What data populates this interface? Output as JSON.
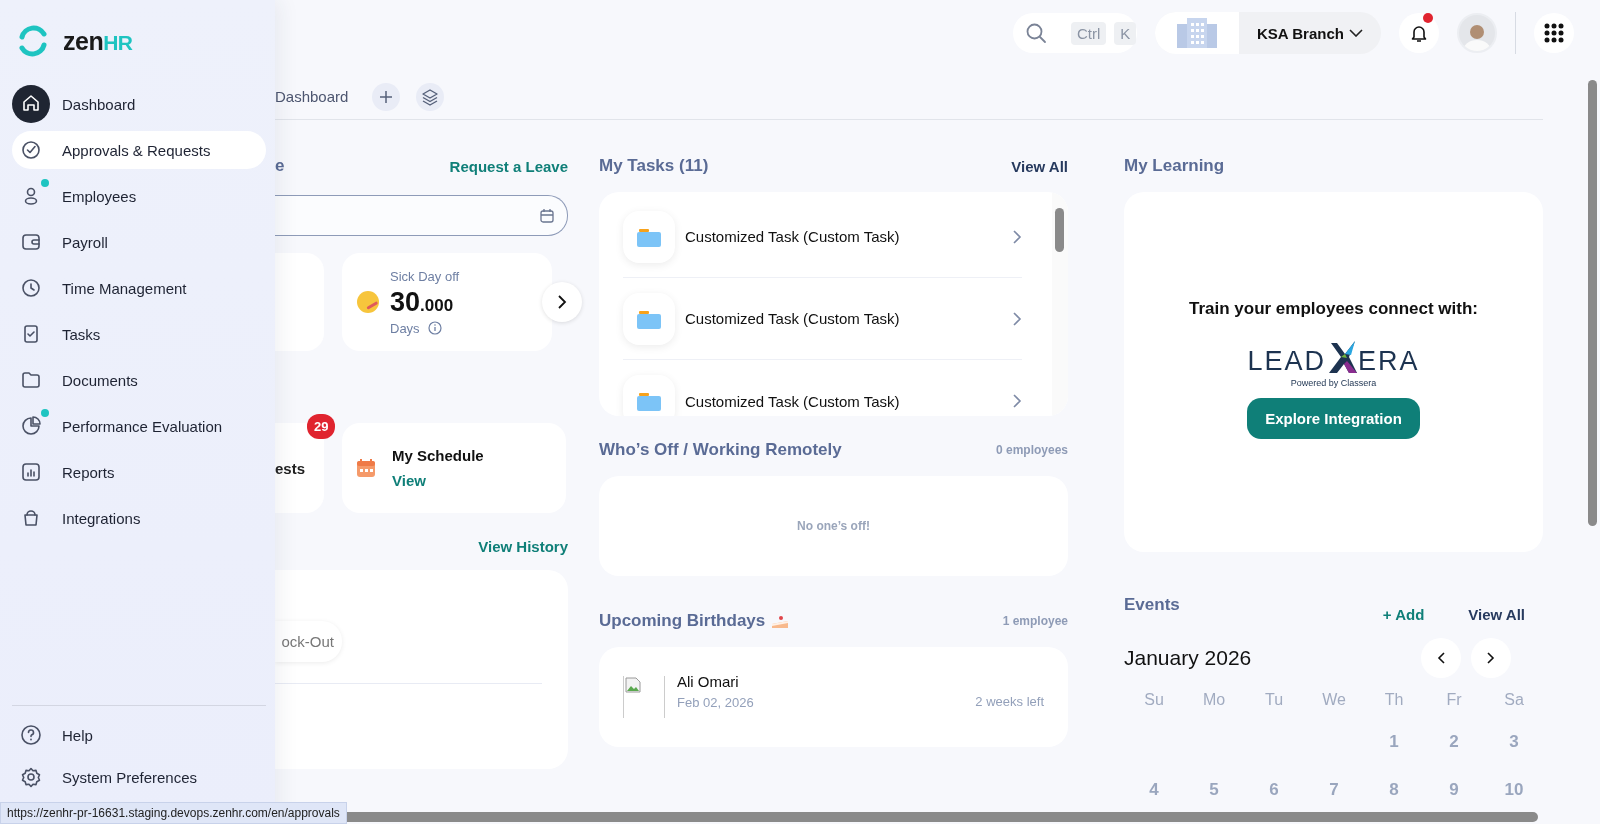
{
  "sidebar": {
    "logo": {
      "word": "zen",
      "accent": "HR"
    },
    "items": [
      {
        "label": "Dashboard",
        "selected": true,
        "highlighted": false,
        "dot": false
      },
      {
        "label": "Approvals & Requests",
        "selected": false,
        "highlighted": true,
        "dot": false
      },
      {
        "label": "Employees",
        "selected": false,
        "highlighted": false,
        "dot": true
      },
      {
        "label": "Payroll",
        "selected": false,
        "highlighted": false,
        "dot": false
      },
      {
        "label": "Time Management",
        "selected": false,
        "highlighted": false,
        "dot": false
      },
      {
        "label": "Tasks",
        "selected": false,
        "highlighted": false,
        "dot": false
      },
      {
        "label": "Documents",
        "selected": false,
        "highlighted": false,
        "dot": false
      },
      {
        "label": "Performance Evaluation",
        "selected": false,
        "highlighted": false,
        "dot": true
      },
      {
        "label": "Reports",
        "selected": false,
        "highlighted": false,
        "dot": false
      },
      {
        "label": "Integrations",
        "selected": false,
        "highlighted": false,
        "dot": false
      }
    ],
    "footer_items": [
      {
        "label": "Help"
      },
      {
        "label": "System Preferences"
      }
    ]
  },
  "header": {
    "search": {
      "keys": [
        "Ctrl",
        "K"
      ]
    },
    "branch": "KSA Branch",
    "unread_notifications": true
  },
  "page_tab": {
    "label": "Dashboard"
  },
  "leave": {
    "title": "e",
    "link": "Request a Leave",
    "balance_cards": [
      {
        "label": "Sick Day off",
        "value": "30",
        "decimals": ".000",
        "unit": "Days"
      }
    ]
  },
  "quick_links": [
    {
      "kind": "cut",
      "label": "ests",
      "badge": "29"
    },
    {
      "kind": "schedule",
      "title": "My Schedule",
      "link": "View"
    }
  ],
  "attendance": {
    "link": "View History",
    "button": "ock-Out"
  },
  "tasks": {
    "title": "My Tasks (11)",
    "link": "View All",
    "items": [
      "Customized Task (Custom Task)",
      "Customized Task (Custom Task)",
      "Customized Task (Custom Task)"
    ]
  },
  "whos_off": {
    "title": "Who’s Off / Working Remotely",
    "count": "0 employees",
    "empty": "No one’s off!"
  },
  "birthdays": {
    "title": "Upcoming Birthdays",
    "count": "1 employee",
    "people": [
      {
        "name": "Ali Omari",
        "date": "Feb 02, 2026",
        "remaining": "2 weeks left"
      }
    ]
  },
  "learning": {
    "title": "My Learning",
    "text": "Train your employees connect with:",
    "logo": {
      "left": "LEAD",
      "right": "ERA",
      "tagline": "Powered by Classera"
    },
    "button": "Explore Integration"
  },
  "events": {
    "title": "Events",
    "add": "+ Add",
    "link": "View All",
    "month": "January 2026",
    "weekdays": [
      "Su",
      "Mo",
      "Tu",
      "We",
      "Th",
      "Fr",
      "Sa"
    ],
    "weeks": [
      [
        "1",
        "2",
        "3"
      ],
      [
        "4",
        "5",
        "6",
        "7",
        "8",
        "9",
        "10"
      ]
    ]
  },
  "status_url": "https://zenhr-pr-16631.staging.devops.zenhr.com/en/approvals"
}
